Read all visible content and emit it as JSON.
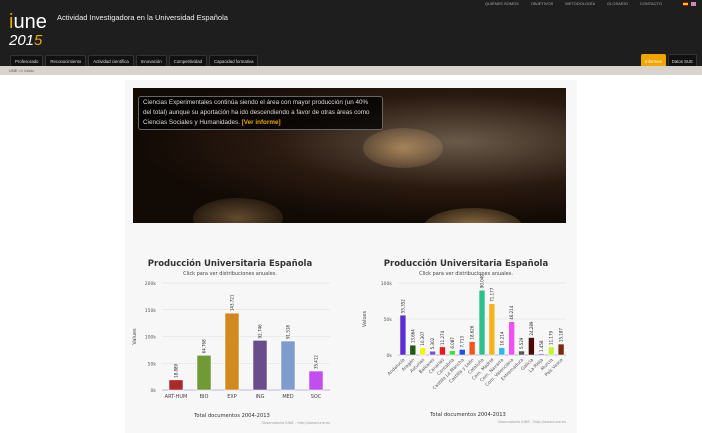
{
  "header": {
    "title": "Actividad Investigadora en la Universidad Española",
    "logo": {
      "word": "iune",
      "year": "2015"
    },
    "top_links": [
      "QUIÉNES SOMOS",
      "OBJETIVOS",
      "METODOLOGÍA",
      "GLOSARIO",
      "CONTACTO"
    ],
    "nav": [
      "Profesorado",
      "Reconocimiento",
      "Actividad científica",
      "Innovación",
      "Competitividad",
      "Capacidad formativa"
    ],
    "right_buttons": [
      "Informes",
      "Datos SUE"
    ]
  },
  "breadcrumb": "UNE >> Inicio",
  "banner": {
    "text": "Ciencias Experimentales continúa siendo el área con mayor producción (un 40% del total) aunque su aportación ha ido descendiendo a favor de otras áreas como Ciencias Sociales y Humanidades.",
    "link": "[Ver informe]"
  },
  "chart_data": [
    {
      "type": "bar",
      "title": "Producción Universitaria Española",
      "subtitle": "Click para ver distribuciones anuales.",
      "ylabel": "Values",
      "xlabel": "Total documentos 2004-2013",
      "credit": "Observatorio IUNE - http://www.iune.es",
      "ylim": [
        0,
        200000
      ],
      "yticks": [
        "0k",
        "50k",
        "100k",
        "150k",
        "200k"
      ],
      "grid": true,
      "categories": [
        "ART-HUM",
        "BIO",
        "EXP",
        "ING",
        "MED",
        "SOC"
      ],
      "values": [
        18889,
        64768,
        143721,
        92746,
        91518,
        35412
      ],
      "labels": [
        "18.889",
        "64.768",
        "143.721",
        "92.746",
        "91.518",
        "35.412"
      ],
      "colors": [
        "#a82a2a",
        "#6f9a35",
        "#d08a1f",
        "#6a4d8c",
        "#7e9dcc",
        "#c34ef0"
      ]
    },
    {
      "type": "bar",
      "title": "Producción Universitaria Española",
      "subtitle": "Click para ver distribuciones anuales.",
      "ylabel": "Values",
      "xlabel": "Total documentos 2004-2013",
      "credit": "Observatorio IUNE - http://www.iune.es",
      "ylim": [
        0,
        100000
      ],
      "yticks": [
        "0k",
        "50k",
        "100k"
      ],
      "grid": true,
      "categories": [
        "Andalucía",
        "Aragón",
        "Asturias",
        "Baleares",
        "Canarias",
        "Cantabria",
        "Castilla La Mancha",
        "Castilla y León",
        "Cataluña",
        "Com. Madrid",
        "Com. Navarra",
        "Com. Valenciana",
        "Extremadura",
        "Galicia",
        "La Rioja",
        "Murcia",
        "País Vasco"
      ],
      "values": [
        55352,
        13664,
        10307,
        5302,
        11274,
        6087,
        7713,
        18626,
        90049,
        71177,
        10214,
        46214,
        5529,
        24289,
        1458,
        11179,
        15187
      ],
      "labels": [
        "55.352",
        "13.664",
        "10.307",
        "5.302",
        "11.274",
        "6.087",
        "7.713",
        "18.626",
        "90.049",
        "71.177",
        "10.214",
        "46.214",
        "5.529",
        "24.289",
        "1.458",
        "11.179",
        "15.187"
      ],
      "colors": [
        "#5a2ed0",
        "#1f5a10",
        "#f2f21e",
        "#7a55e0",
        "#e81a1a",
        "#3ee03e",
        "#1f4ee8",
        "#f2561e",
        "#2ec08a",
        "#f5b31e",
        "#33b5f0",
        "#f050f0",
        "#555555",
        "#4a0a0a",
        "#3a3af0",
        "#c8f03a",
        "#7a2a10"
      ]
    }
  ]
}
